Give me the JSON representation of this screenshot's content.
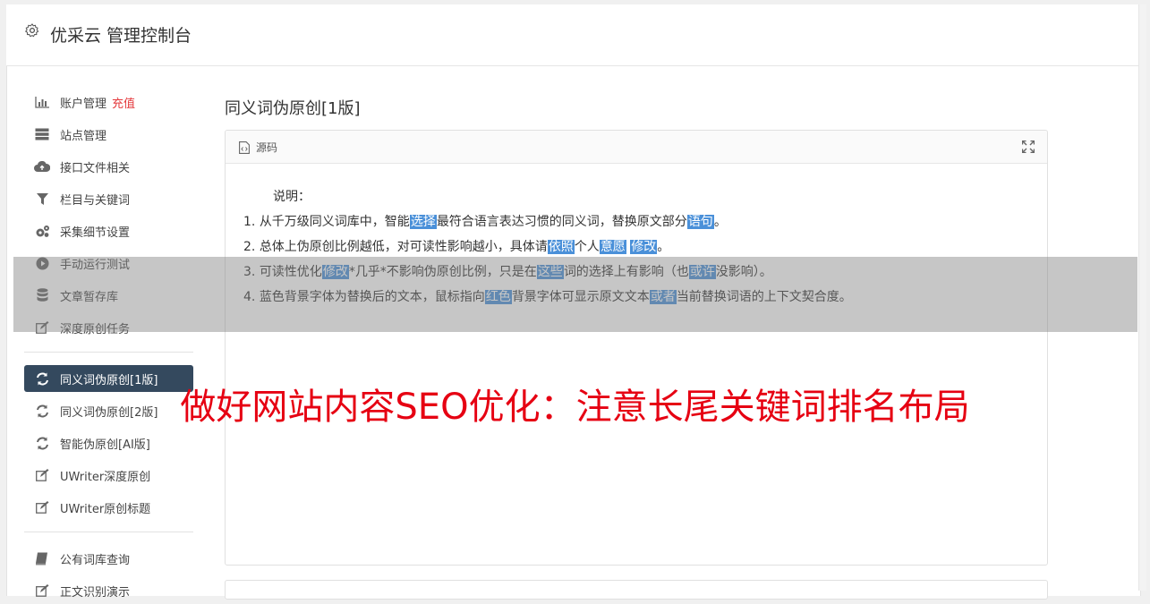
{
  "header": {
    "title": "优采云 管理控制台"
  },
  "sidebar": {
    "items": [
      {
        "label": "账户管理",
        "badge": "充值",
        "icon": "bar-chart-icon"
      },
      {
        "label": "站点管理",
        "icon": "server-icon"
      },
      {
        "label": "接口文件相关",
        "icon": "cloud-upload-icon"
      },
      {
        "label": "栏目与关键词",
        "icon": "filter-icon"
      },
      {
        "label": "采集细节设置",
        "icon": "gears-icon"
      },
      {
        "label": "手动运行测试",
        "icon": "play-circle-icon"
      },
      {
        "label": "文章暂存库",
        "icon": "database-icon"
      },
      {
        "label": "深度原创任务",
        "icon": "edit-icon"
      },
      {
        "label": "同义词伪原创[1版]",
        "icon": "refresh-icon",
        "active": true
      },
      {
        "label": "同义词伪原创[2版]",
        "icon": "refresh-icon"
      },
      {
        "label": "智能伪原创[AI版]",
        "icon": "refresh-icon"
      },
      {
        "label": "UWriter深度原创",
        "icon": "edit-icon"
      },
      {
        "label": "UWriter原创标题",
        "icon": "edit-icon"
      },
      {
        "label": "公有词库查询",
        "icon": "book-icon"
      },
      {
        "label": "正文识别演示",
        "icon": "edit-icon"
      }
    ]
  },
  "main": {
    "heading": "同义词伪原创[1版]",
    "panel": {
      "source_label": "源码",
      "intro": "说明：",
      "lines": [
        {
          "num": "1.",
          "segments": [
            [
              "从千万级同义词库中，智能",
              false
            ],
            [
              "选择",
              true
            ],
            [
              "最符合语言表达习惯的同义词，替换原文部分",
              false
            ],
            [
              "语句",
              true
            ],
            [
              "。",
              false
            ]
          ]
        },
        {
          "num": "2.",
          "segments": [
            [
              "总体上伪原创比例越低，对可读性影响越小，具体请",
              false
            ],
            [
              "依照",
              true
            ],
            [
              "个人",
              false
            ],
            [
              "意愿",
              true
            ],
            [
              " ",
              false
            ],
            [
              "修改",
              true
            ],
            [
              "。",
              false
            ]
          ]
        },
        {
          "num": "3.",
          "segments": [
            [
              "可读性优化",
              false
            ],
            [
              "修改",
              true
            ],
            [
              "*几乎*不影响伪原创比例，只是在",
              false
            ],
            [
              "这些",
              true
            ],
            [
              "词的选择上有影响（也",
              false
            ],
            [
              "或许",
              true
            ],
            [
              "没影响）。",
              false
            ]
          ]
        },
        {
          "num": "4.",
          "segments": [
            [
              "蓝色背景字体为替换后的文本，鼠标指向",
              false
            ],
            [
              "红色",
              true
            ],
            [
              "背景字体可显示原文文本",
              false
            ],
            [
              "或者",
              true
            ],
            [
              "当前替换词语的上下文契合度。",
              false
            ]
          ]
        }
      ]
    }
  },
  "overlay": {
    "text": "做好网站内容SEO优化：注意长尾关键词排名布局"
  },
  "colors": {
    "active_bg": "#34495e",
    "highlight": "#4a90d9",
    "watermark": "#e60012",
    "recharge": "#e4393c"
  }
}
